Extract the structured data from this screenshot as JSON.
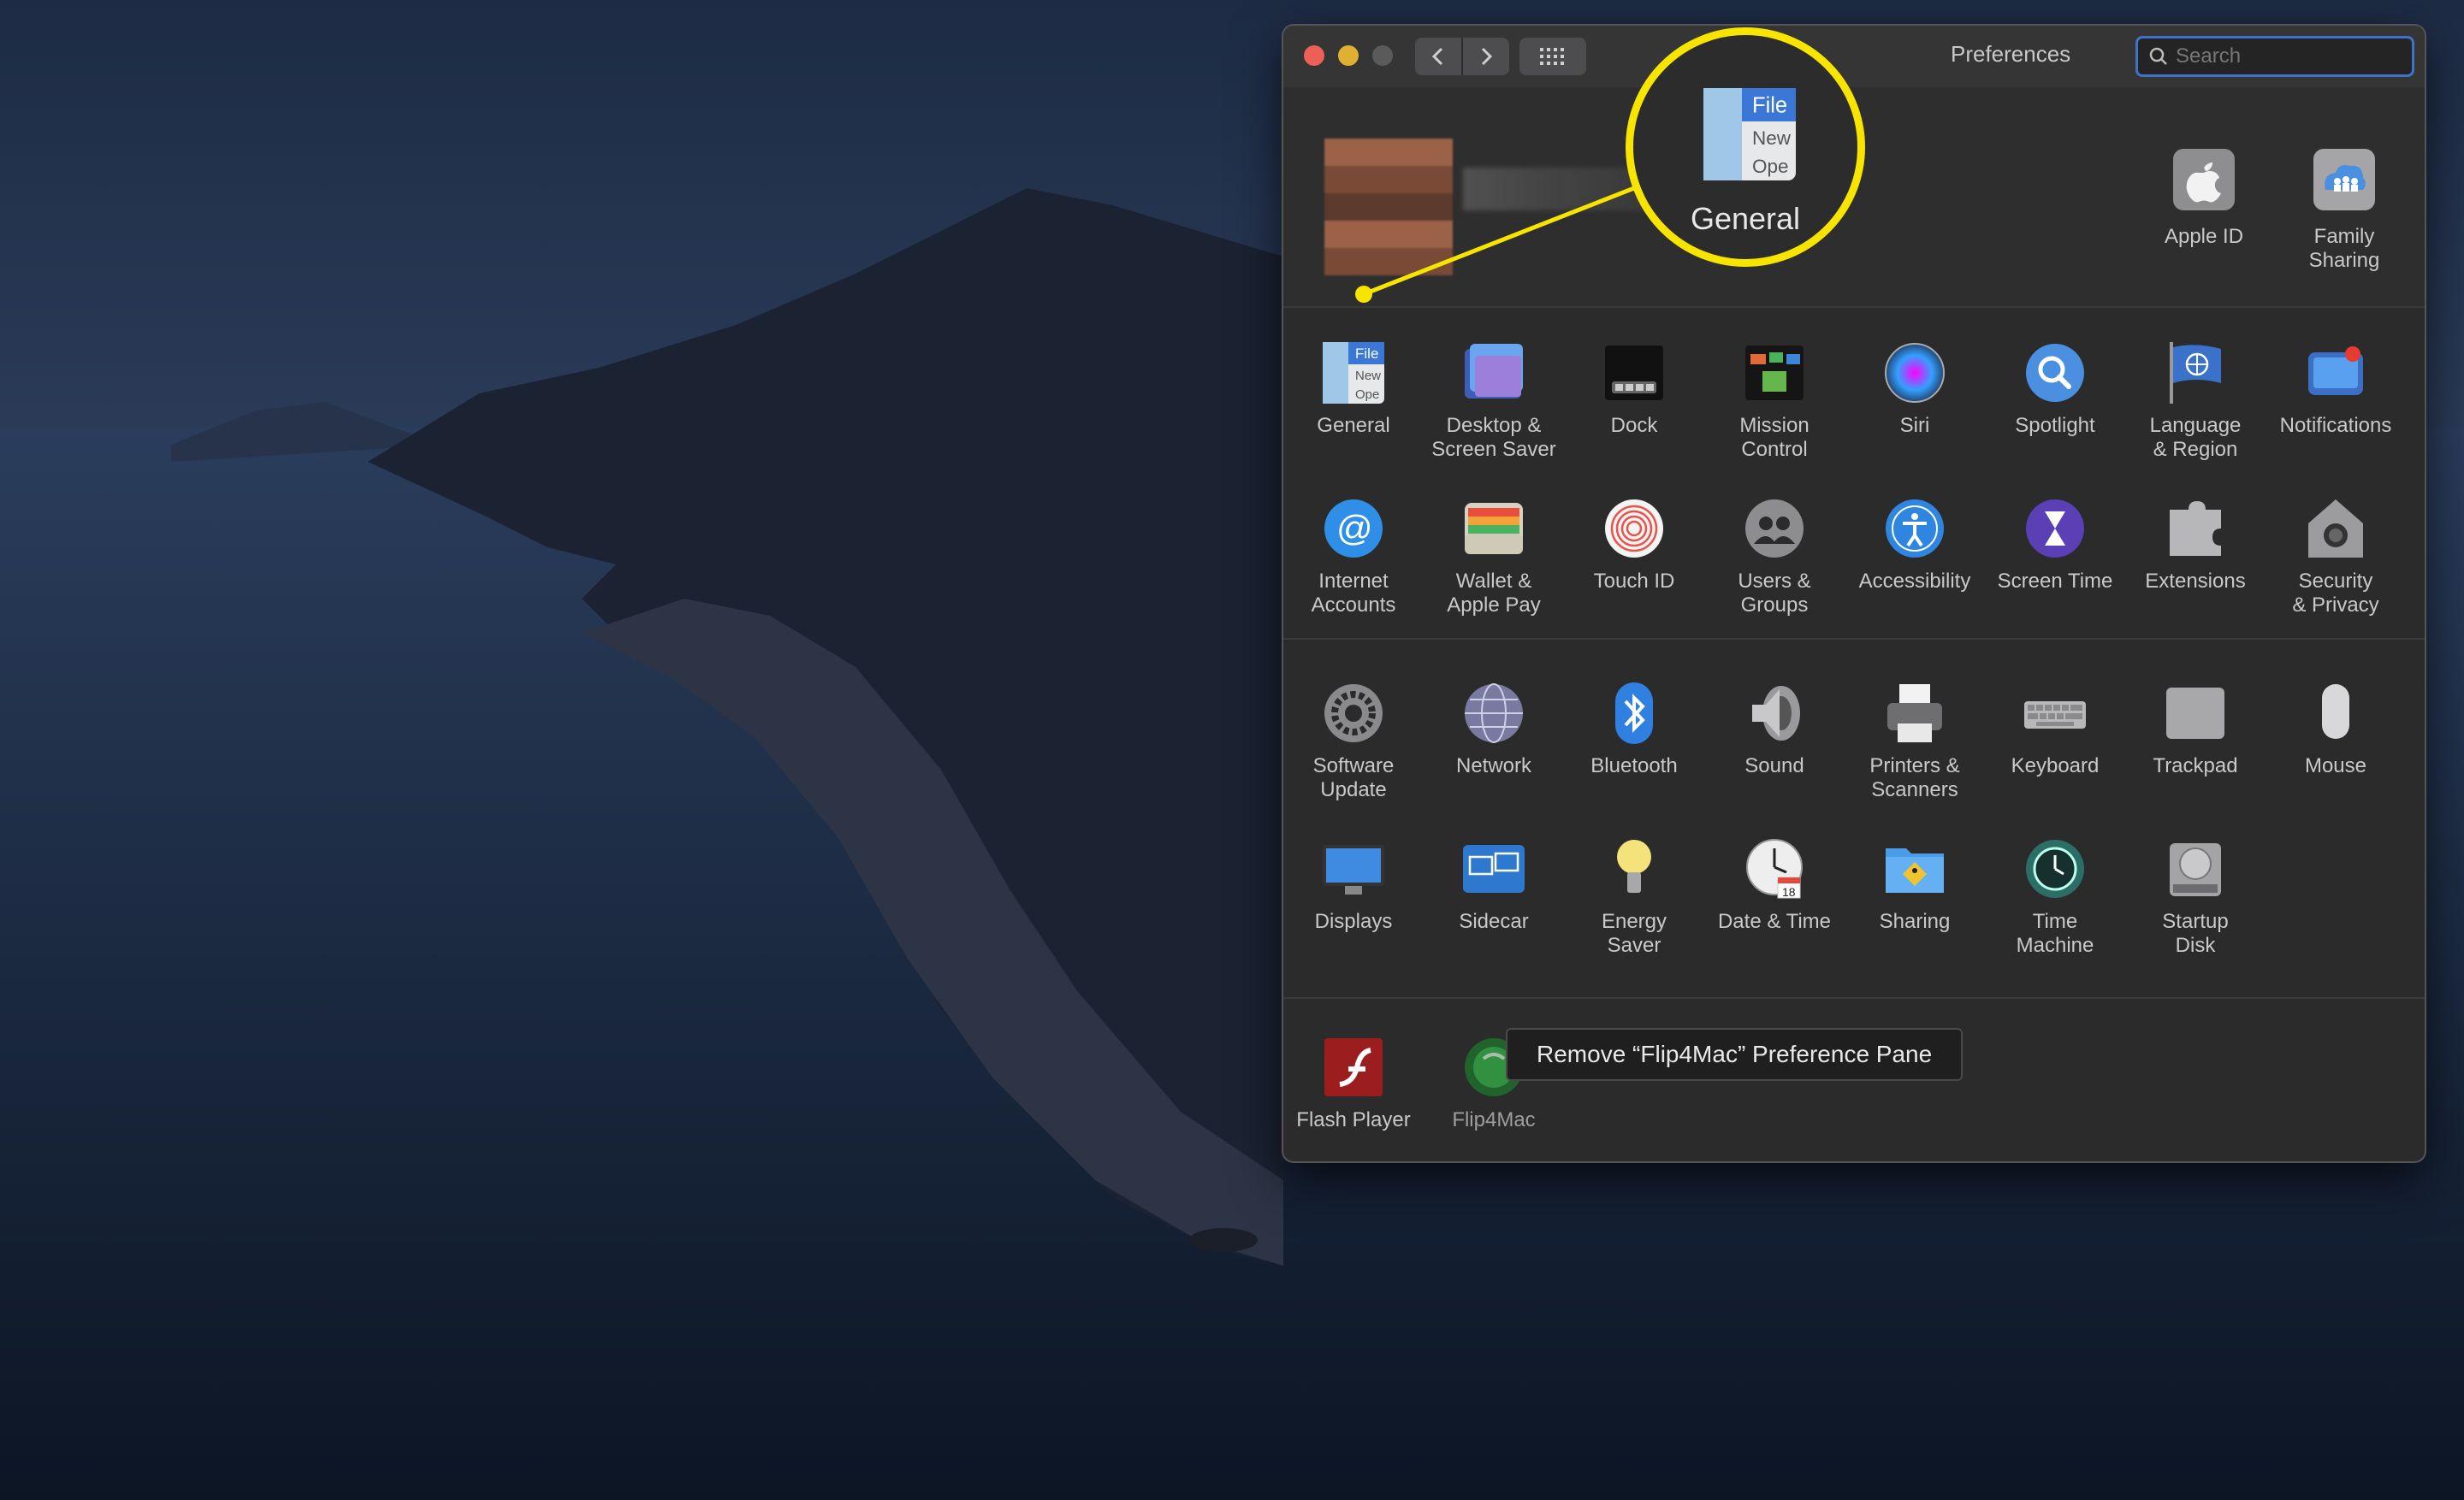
{
  "window": {
    "title": "Preferences",
    "search_placeholder": "Search"
  },
  "account": {
    "items": [
      {
        "label": "Apple ID",
        "icon": "apple-icon"
      },
      {
        "label": "Family\nSharing",
        "icon": "family-sharing-icon"
      }
    ]
  },
  "annotation": {
    "label": "General",
    "color": "#f7e500"
  },
  "section1": [
    {
      "label": "General",
      "icon": "general-icon"
    },
    {
      "label": "Desktop &\nScreen Saver",
      "icon": "desktop-icon"
    },
    {
      "label": "Dock",
      "icon": "dock-icon"
    },
    {
      "label": "Mission\nControl",
      "icon": "mission-control-icon"
    },
    {
      "label": "Siri",
      "icon": "siri-icon"
    },
    {
      "label": "Spotlight",
      "icon": "spotlight-icon"
    },
    {
      "label": "Language\n& Region",
      "icon": "language-icon"
    },
    {
      "label": "Notifications",
      "icon": "notifications-icon"
    },
    {
      "label": "Internet\nAccounts",
      "icon": "internet-accounts-icon"
    },
    {
      "label": "Wallet &\nApple Pay",
      "icon": "wallet-icon"
    },
    {
      "label": "Touch ID",
      "icon": "touch-id-icon"
    },
    {
      "label": "Users &\nGroups",
      "icon": "users-icon"
    },
    {
      "label": "Accessibility",
      "icon": "accessibility-icon"
    },
    {
      "label": "Screen Time",
      "icon": "screen-time-icon"
    },
    {
      "label": "Extensions",
      "icon": "extensions-icon"
    },
    {
      "label": "Security\n& Privacy",
      "icon": "security-icon"
    }
  ],
  "section2": [
    {
      "label": "Software\nUpdate",
      "icon": "software-update-icon"
    },
    {
      "label": "Network",
      "icon": "network-icon"
    },
    {
      "label": "Bluetooth",
      "icon": "bluetooth-icon"
    },
    {
      "label": "Sound",
      "icon": "sound-icon"
    },
    {
      "label": "Printers &\nScanners",
      "icon": "printer-icon"
    },
    {
      "label": "Keyboard",
      "icon": "keyboard-icon"
    },
    {
      "label": "Trackpad",
      "icon": "trackpad-icon"
    },
    {
      "label": "Mouse",
      "icon": "mouse-icon"
    },
    {
      "label": "Displays",
      "icon": "displays-icon"
    },
    {
      "label": "Sidecar",
      "icon": "sidecar-icon"
    },
    {
      "label": "Energy\nSaver",
      "icon": "energy-saver-icon"
    },
    {
      "label": "Date & Time",
      "icon": "date-time-icon"
    },
    {
      "label": "Sharing",
      "icon": "sharing-icon"
    },
    {
      "label": "Time\nMachine",
      "icon": "time-machine-icon"
    },
    {
      "label": "Startup\nDisk",
      "icon": "startup-disk-icon"
    }
  ],
  "section3": [
    {
      "label": "Flash Player",
      "icon": "flash-player-icon"
    },
    {
      "label": "Flip4Mac",
      "icon": "flip4mac-icon"
    }
  ],
  "tooltip": {
    "text": "Remove “Flip4Mac” Preference Pane"
  },
  "general_icon": {
    "file_text": "File",
    "new_text": "New",
    "open_text": "Ope"
  },
  "date_icon_day": "18"
}
